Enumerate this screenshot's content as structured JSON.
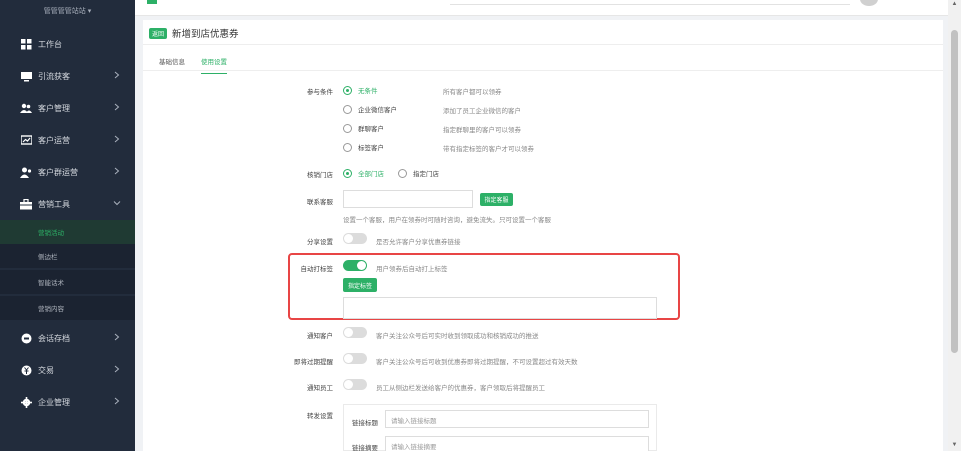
{
  "sidebar": {
    "brand": "管管管管站站 ▾",
    "items": [
      {
        "label": "工作台",
        "icon": "dashboard-icon"
      },
      {
        "label": "引流获客",
        "icon": "monitor-icon"
      },
      {
        "label": "客户管理",
        "icon": "users-icon"
      },
      {
        "label": "客户运营",
        "icon": "chart-icon"
      },
      {
        "label": "客户群运营",
        "icon": "group-icon"
      },
      {
        "label": "营销工具",
        "icon": "briefcase-icon"
      },
      {
        "label": "会话存档",
        "icon": "archive-icon"
      },
      {
        "label": "交易",
        "icon": "yen-icon"
      },
      {
        "label": "企业管理",
        "icon": "gear-icon"
      }
    ],
    "sub_items": [
      "营销活动",
      "侧边栏",
      "智能话术",
      "营销内容"
    ]
  },
  "header": {
    "back_label": "返回",
    "title": "新增到店优惠券"
  },
  "tabs": [
    "基础信息",
    "使用设置"
  ],
  "form": {
    "participation": {
      "label": "参与条件",
      "options": [
        {
          "label": "无条件",
          "desc": "所有客户都可以领券"
        },
        {
          "label": "企业微信客户",
          "desc": "添加了员工企业微信的客户"
        },
        {
          "label": "群聊客户",
          "desc": "指定群聊里的客户可以领券"
        },
        {
          "label": "标签客户",
          "desc": "带有指定标签的客户才可以领券"
        }
      ]
    },
    "store": {
      "label": "核销门店",
      "options": [
        "全部门店",
        "指定门店"
      ]
    },
    "contact": {
      "label": "联系客服",
      "button": "指定客服",
      "hint": "设置一个客服，用户在领券时可随时咨询，避免流失。只可设置一个客服"
    },
    "share": {
      "label": "分享设置",
      "desc": "是否允许客户分享优惠券链接"
    },
    "auto_tag": {
      "label": "自动打标签",
      "desc": "用户领券后自动打上标签",
      "button": "指定标签"
    },
    "notify_customer": {
      "label": "通知客户",
      "desc": "客户关注公众号后可实时收到领取成功和核销成功的推送"
    },
    "expire_remind": {
      "label": "即将过期提醒",
      "desc": "客户关注公众号后可收到优惠券即将过期提醒，不可设置超过有效天数"
    },
    "notify_staff": {
      "label": "通知员工",
      "desc": "员工从侧边栏发送给客户的优惠券，客户领取后将提醒员工"
    },
    "forward": {
      "label": "转发设置",
      "link_title_label": "链接标题",
      "link_title_placeholder": "请输入链接标题",
      "link_desc_label": "链接摘要",
      "link_desc_placeholder": "请输入链接摘要"
    }
  },
  "colors": {
    "accent": "#2db067",
    "sidebar_bg": "#222c3c",
    "highlight_border": "#e84545"
  }
}
